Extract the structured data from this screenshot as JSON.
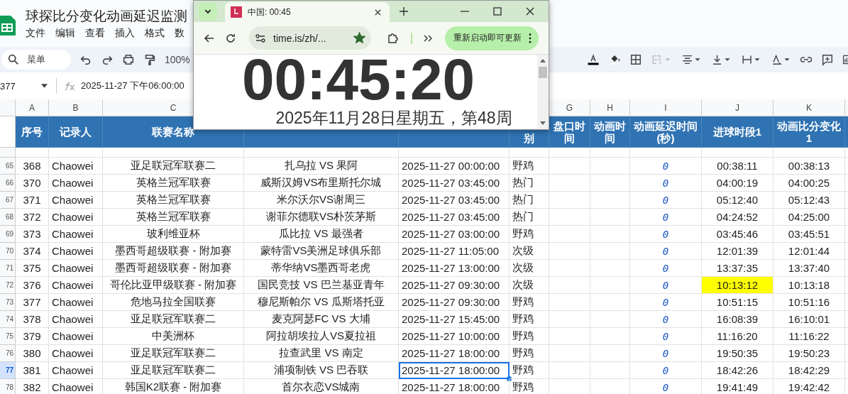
{
  "sheet": {
    "title": "球探比分变化动画延迟监测",
    "menus": [
      "文件",
      "编辑",
      "查看",
      "插入",
      "格式",
      "数"
    ],
    "search_placeholder": "菜单",
    "zoom": "100%",
    "name_box": "377",
    "formula": "2025-11-27 下午06:00:00"
  },
  "columns": [
    {
      "letter": "A",
      "header": "序号"
    },
    {
      "letter": "B",
      "header": "记录人"
    },
    {
      "letter": "C",
      "header": "联赛名称"
    },
    {},
    {},
    {
      "header": "别"
    },
    {
      "letter": "G",
      "header": "盘口时间"
    },
    {
      "letter": "H",
      "header": "动画时间"
    },
    {
      "letter": "I",
      "header": "动画延迟时间(秒)"
    },
    {
      "letter": "J",
      "header": "进球时段1"
    },
    {
      "letter": "K",
      "header": "动画比分变化1"
    }
  ],
  "rows": [
    {
      "row": "65",
      "selected": false,
      "goal_highlight": false,
      "no": "368",
      "recorder": "Chaowei",
      "league": "亚足联冠军联赛二",
      "match": "扎乌拉 VS 果阿",
      "start": "2025-11-27 00:00:00",
      "level": "野鸡",
      "delay": "0",
      "goal_time": "00:38:11",
      "anim_change": "00:38:13"
    },
    {
      "row": "66",
      "selected": false,
      "goal_highlight": false,
      "no": "370",
      "recorder": "Chaowei",
      "league": "英格兰冠军联赛",
      "match": "威斯汉姆VS布里斯托尔城",
      "start": "2025-11-27 03:45:00",
      "level": "热门",
      "delay": "0",
      "goal_time": "04:00:19",
      "anim_change": "04:00:25"
    },
    {
      "row": "67",
      "selected": false,
      "goal_highlight": false,
      "no": "371",
      "recorder": "Chaowei",
      "league": "英格兰冠军联赛",
      "match": "米尔沃尔VS谢周三",
      "start": "2025-11-27 03:45:00",
      "level": "热门",
      "delay": "0",
      "goal_time": "05:12:40",
      "anim_change": "05:12:43"
    },
    {
      "row": "68",
      "selected": false,
      "goal_highlight": false,
      "no": "372",
      "recorder": "Chaowei",
      "league": "英格兰冠军联赛",
      "match": "谢菲尔德联VS朴茨茅斯",
      "start": "2025-11-27 03:45:00",
      "level": "热门",
      "delay": "0",
      "goal_time": "04:24:52",
      "anim_change": "04:25:00"
    },
    {
      "row": "69",
      "selected": false,
      "goal_highlight": false,
      "no": "373",
      "recorder": "Chaowei",
      "league": "玻利维亚杯",
      "match": "瓜比拉 VS 最强者",
      "start": "2025-11-27 03:00:00",
      "level": "野鸡",
      "delay": "0",
      "goal_time": "03:45:46",
      "anim_change": "03:45:51"
    },
    {
      "row": "70",
      "selected": false,
      "goal_highlight": false,
      "no": "374",
      "recorder": "Chaowei",
      "league": "墨西哥超级联赛 - 附加赛",
      "match": "蒙特雷VS美洲足球俱乐部",
      "start": "2025-11-27 11:05:00",
      "level": "次级",
      "delay": "0",
      "goal_time": "12:01:39",
      "anim_change": "12:01:44"
    },
    {
      "row": "71",
      "selected": false,
      "goal_highlight": false,
      "no": "375",
      "recorder": "Chaowei",
      "league": "墨西哥超级联赛 - 附加赛",
      "match": "蒂华纳VS墨西哥老虎",
      "start": "2025-11-27 13:00:00",
      "level": "次级",
      "delay": "0",
      "goal_time": "13:37:35",
      "anim_change": "13:37:40"
    },
    {
      "row": "72",
      "selected": false,
      "goal_highlight": true,
      "no": "376",
      "recorder": "Chaowei",
      "league": "哥伦比亚甲级联赛 - 附加赛",
      "match": "国民竞技 VS 巴兰基亚青年",
      "start": "2025-11-27 09:30:00",
      "level": "次级",
      "delay": "0",
      "goal_time": "10:13:12",
      "anim_change": "10:13:18"
    },
    {
      "row": "73",
      "selected": false,
      "goal_highlight": false,
      "no": "377",
      "recorder": "Chaowei",
      "league": "危地马拉全国联赛",
      "match": "穆尼斯帕尔 VS 瓜斯塔托亚",
      "start": "2025-11-27 09:30:00",
      "level": "野鸡",
      "delay": "0",
      "goal_time": "10:51:15",
      "anim_change": "10:51:16"
    },
    {
      "row": "74",
      "selected": false,
      "goal_highlight": false,
      "no": "378",
      "recorder": "Chaowei",
      "league": "亚足联冠军联赛二",
      "match": "麦克阿瑟FC VS 大埔",
      "start": "2025-11-27 15:45:00",
      "level": "野鸡",
      "delay": "0",
      "goal_time": "16:08:39",
      "anim_change": "16:10:01"
    },
    {
      "row": "75",
      "selected": false,
      "goal_highlight": false,
      "no": "379",
      "recorder": "Chaowei",
      "league": "中美洲杯",
      "match": "阿拉胡埃拉人VS夏拉祖",
      "start": "2025-11-27 10:00:00",
      "level": "野鸡",
      "delay": "0",
      "goal_time": "11:16:20",
      "anim_change": "11:16:22"
    },
    {
      "row": "76",
      "selected": false,
      "goal_highlight": false,
      "no": "380",
      "recorder": "Chaowei",
      "league": "亚足联冠军联赛二",
      "match": "拉查武里 VS 南定",
      "start": "2025-11-27 18:00:00",
      "level": "野鸡",
      "delay": "0",
      "goal_time": "19:50:35",
      "anim_change": "19:50:23"
    },
    {
      "row": "77",
      "selected": true,
      "goal_highlight": false,
      "no": "381",
      "recorder": "Chaowei",
      "league": "亚足联冠军联赛二",
      "match": "浦项制铁 VS 巴吞联",
      "start": "2025-11-27 18:00:00",
      "level": "野鸡",
      "delay": "0",
      "goal_time": "18:42:26",
      "anim_change": "18:42:29"
    },
    {
      "row": "78",
      "selected": false,
      "goal_highlight": false,
      "no": "382",
      "recorder": "Chaowei",
      "league": "韩国K2联赛 - 附加赛",
      "match": "首尔衣恋VS城南",
      "start": "2025-11-27 18:00:00",
      "level": "野鸡",
      "delay": "0",
      "goal_time": "19:41:49",
      "anim_change": "19:42:42"
    }
  ],
  "browser": {
    "tab_title": "中国: 00:45",
    "url": "time.is/zh/...",
    "bookmarked": true,
    "update_button": "重新启动即可更新",
    "clock": "00:45:20",
    "date": "2025年11月28日星期五，第48周"
  }
}
